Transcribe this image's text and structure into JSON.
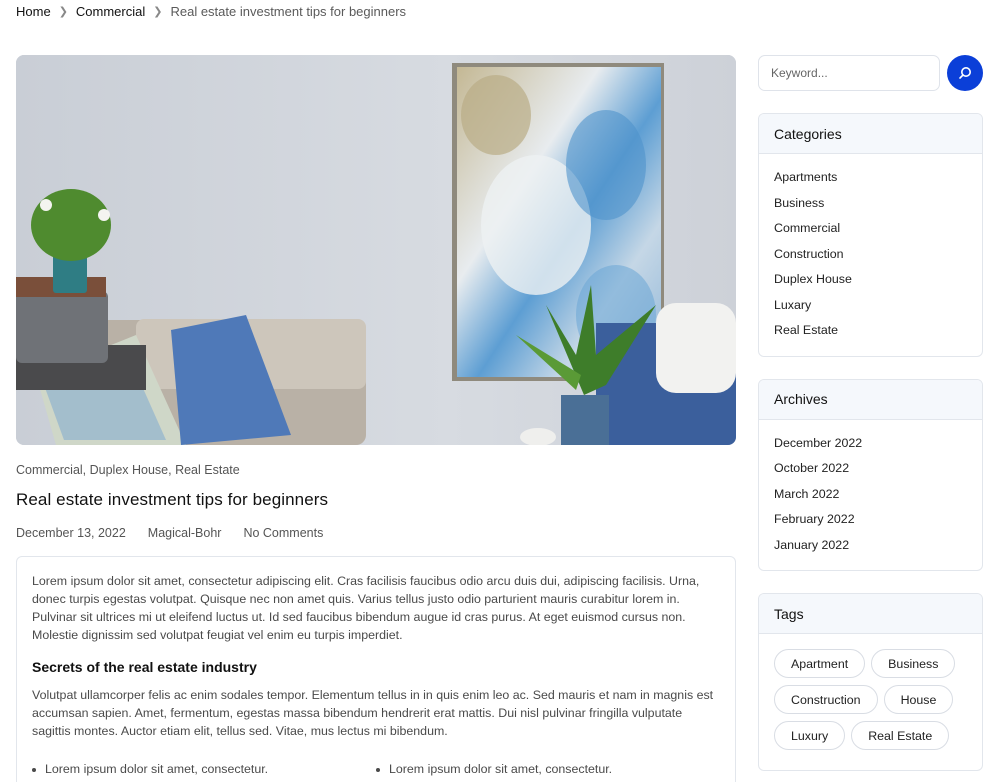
{
  "breadcrumb": {
    "home": "Home",
    "category": "Commercial",
    "current": "Real estate investment tips for beginners"
  },
  "post": {
    "categories": "Commercial, Duplex House, Real Estate",
    "title": "Real estate investment tips for beginners",
    "date": "December 13, 2022",
    "author": "Magical-Bohr",
    "comments": "No Comments",
    "paragraph1": "Lorem ipsum dolor sit amet, consectetur adipiscing elit. Cras facilisis faucibus odio arcu duis dui, adipiscing facilisis. Urna, donec turpis egestas volutpat. Quisque nec non amet quis. Varius tellus justo odio parturient mauris curabitur lorem in. Pulvinar sit ultrices mi ut eleifend luctus ut. Id sed faucibus bibendum augue id cras purus. At eget euismod cursus non. Molestie dignissim sed volutpat feugiat vel enim eu turpis imperdiet.",
    "subheading": "Secrets of the real estate industry",
    "paragraph2": "Volutpat ullamcorper felis ac enim sodales tempor. Elementum tellus in in quis enim leo ac. Sed mauris et nam in magnis est accumsan sapien. Amet, fermentum, egestas massa bibendum hendrerit erat mattis. Dui nisl pulvinar fringilla vulputate sagittis montes. Auctor etiam elit, tellus sed. Vitae, mus lectus mi bibendum.",
    "list": [
      "Lorem ipsum dolor sit amet, consectetur.",
      "Lorem ipsum dolor sit amet, consectetur."
    ]
  },
  "sidebar": {
    "search_placeholder": "Keyword...",
    "categories_title": "Categories",
    "categories": [
      "Apartments",
      "Business",
      "Commercial",
      "Construction",
      "Duplex House",
      "Luxary",
      "Real Estate"
    ],
    "archives_title": "Archives",
    "archives": [
      "December 2022",
      "October 2022",
      "March 2022",
      "February 2022",
      "January 2022"
    ],
    "tags_title": "Tags",
    "tags": [
      "Apartment",
      "Business",
      "Construction",
      "House",
      "Luxury",
      "Real Estate"
    ]
  },
  "colors": {
    "accent": "#0b3fd8",
    "widget_header_bg": "#f5f8fc",
    "border": "#e2e6ec"
  },
  "icons": {
    "breadcrumb_separator": "chevron-right-icon",
    "search": "search-icon"
  }
}
